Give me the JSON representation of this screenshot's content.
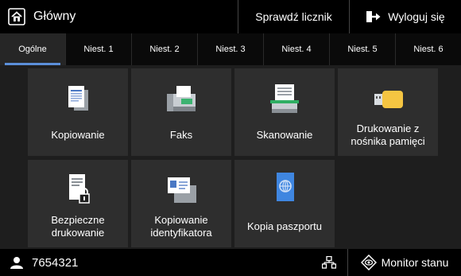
{
  "header": {
    "title": "Główny",
    "counter_label": "Sprawdź licznik",
    "logout_label": "Wyloguj się"
  },
  "tabs": [
    {
      "label": "Ogólne",
      "active": true
    },
    {
      "label": "Niest. 1"
    },
    {
      "label": "Niest. 2"
    },
    {
      "label": "Niest. 3"
    },
    {
      "label": "Niest. 4"
    },
    {
      "label": "Niest. 5"
    },
    {
      "label": "Niest. 6"
    }
  ],
  "tiles": [
    {
      "label": "Kopiowanie",
      "icon": "copy-icon"
    },
    {
      "label": "Faks",
      "icon": "fax-icon"
    },
    {
      "label": "Skanowanie",
      "icon": "scan-icon"
    },
    {
      "label": "Drukowanie z nośnika pamięci",
      "icon": "usb-memory-icon"
    },
    {
      "label": "Bezpieczne drukowanie",
      "icon": "secure-print-icon"
    },
    {
      "label": "Kopiowanie identyfikatora",
      "icon": "id-card-copy-icon"
    },
    {
      "label": "Kopia paszportu",
      "icon": "passport-copy-icon"
    }
  ],
  "footer": {
    "user_id": "7654321",
    "monitor_label": "Monitor stanu"
  },
  "colors": {
    "accent": "#5b8fd9",
    "tile_bg": "#2e2e2e",
    "page_bg": "#1e1e1e"
  }
}
